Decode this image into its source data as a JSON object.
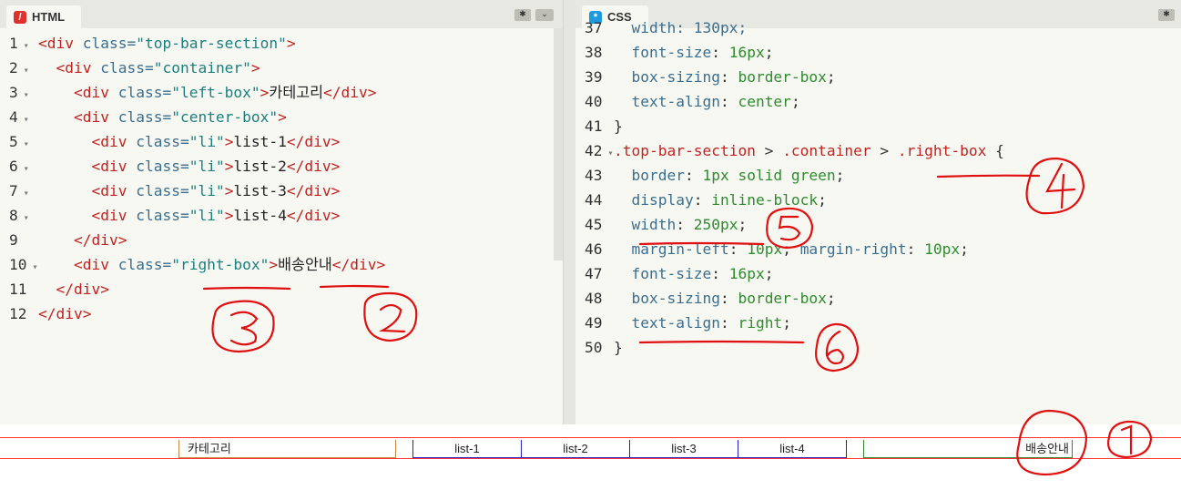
{
  "html_editor": {
    "tab_label": "HTML",
    "icon": "html-icon",
    "lines": [
      {
        "n": "1",
        "fold": true,
        "tokens": [
          {
            "c": "tag",
            "t": "<div "
          },
          {
            "c": "attr",
            "t": "class="
          },
          {
            "c": "str",
            "t": "\"top-bar-section\""
          },
          {
            "c": "tag",
            "t": ">"
          }
        ]
      },
      {
        "n": "2",
        "fold": true,
        "tokens": [
          {
            "c": "txt",
            "t": "  "
          },
          {
            "c": "tag",
            "t": "<div "
          },
          {
            "c": "attr",
            "t": "class="
          },
          {
            "c": "str",
            "t": "\"container\""
          },
          {
            "c": "tag",
            "t": ">"
          }
        ]
      },
      {
        "n": "3",
        "fold": true,
        "tokens": [
          {
            "c": "txt",
            "t": "    "
          },
          {
            "c": "tag",
            "t": "<div "
          },
          {
            "c": "attr",
            "t": "class="
          },
          {
            "c": "str",
            "t": "\"left-box\""
          },
          {
            "c": "tag",
            "t": ">"
          },
          {
            "c": "txt",
            "t": "카테고리"
          },
          {
            "c": "tag",
            "t": "</div>"
          }
        ]
      },
      {
        "n": "4",
        "fold": true,
        "tokens": [
          {
            "c": "txt",
            "t": "    "
          },
          {
            "c": "tag",
            "t": "<div "
          },
          {
            "c": "attr",
            "t": "class="
          },
          {
            "c": "str",
            "t": "\"center-box\""
          },
          {
            "c": "tag",
            "t": ">"
          }
        ]
      },
      {
        "n": "5",
        "fold": true,
        "tokens": [
          {
            "c": "txt",
            "t": "      "
          },
          {
            "c": "tag",
            "t": "<div "
          },
          {
            "c": "attr",
            "t": "class="
          },
          {
            "c": "str",
            "t": "\"li\""
          },
          {
            "c": "tag",
            "t": ">"
          },
          {
            "c": "txt",
            "t": "list-1"
          },
          {
            "c": "tag",
            "t": "</div>"
          }
        ]
      },
      {
        "n": "6",
        "fold": true,
        "tokens": [
          {
            "c": "txt",
            "t": "      "
          },
          {
            "c": "tag",
            "t": "<div "
          },
          {
            "c": "attr",
            "t": "class="
          },
          {
            "c": "str",
            "t": "\"li\""
          },
          {
            "c": "tag",
            "t": ">"
          },
          {
            "c": "txt",
            "t": "list-2"
          },
          {
            "c": "tag",
            "t": "</div>"
          }
        ]
      },
      {
        "n": "7",
        "fold": true,
        "tokens": [
          {
            "c": "txt",
            "t": "      "
          },
          {
            "c": "tag",
            "t": "<div "
          },
          {
            "c": "attr",
            "t": "class="
          },
          {
            "c": "str",
            "t": "\"li\""
          },
          {
            "c": "tag",
            "t": ">"
          },
          {
            "c": "txt",
            "t": "list-3"
          },
          {
            "c": "tag",
            "t": "</div>"
          }
        ]
      },
      {
        "n": "8",
        "fold": true,
        "tokens": [
          {
            "c": "txt",
            "t": "      "
          },
          {
            "c": "tag",
            "t": "<div "
          },
          {
            "c": "attr",
            "t": "class="
          },
          {
            "c": "str",
            "t": "\"li\""
          },
          {
            "c": "tag",
            "t": ">"
          },
          {
            "c": "txt",
            "t": "list-4"
          },
          {
            "c": "tag",
            "t": "</div>"
          }
        ]
      },
      {
        "n": "9",
        "fold": false,
        "tokens": [
          {
            "c": "txt",
            "t": "    "
          },
          {
            "c": "tag",
            "t": "</div>"
          }
        ]
      },
      {
        "n": "10",
        "fold": true,
        "tokens": [
          {
            "c": "txt",
            "t": "    "
          },
          {
            "c": "tag",
            "t": "<div "
          },
          {
            "c": "attr",
            "t": "class="
          },
          {
            "c": "str",
            "t": "\"right-box\""
          },
          {
            "c": "tag",
            "t": ">"
          },
          {
            "c": "txt",
            "t": "배송안내"
          },
          {
            "c": "tag",
            "t": "</div>"
          }
        ]
      },
      {
        "n": "11",
        "fold": false,
        "tokens": [
          {
            "c": "txt",
            "t": "  "
          },
          {
            "c": "tag",
            "t": "</div>"
          }
        ]
      },
      {
        "n": "12",
        "fold": false,
        "tokens": [
          {
            "c": "tag",
            "t": "</div>"
          }
        ]
      }
    ]
  },
  "css_editor": {
    "tab_label": "CSS",
    "icon": "css-icon",
    "partial_line": {
      "n": "37",
      "text": "  width: 130px;"
    },
    "lines": [
      {
        "n": "38",
        "fold": false,
        "tokens": [
          {
            "c": "prop",
            "t": "  font-size"
          },
          {
            "c": "pun",
            "t": ": "
          },
          {
            "c": "val",
            "t": "16px"
          },
          {
            "c": "pun",
            "t": ";"
          }
        ]
      },
      {
        "n": "39",
        "fold": false,
        "tokens": [
          {
            "c": "prop",
            "t": "  box-sizing"
          },
          {
            "c": "pun",
            "t": ": "
          },
          {
            "c": "val",
            "t": "border-box"
          },
          {
            "c": "pun",
            "t": ";"
          }
        ]
      },
      {
        "n": "40",
        "fold": false,
        "tokens": [
          {
            "c": "prop",
            "t": "  text-align"
          },
          {
            "c": "pun",
            "t": ": "
          },
          {
            "c": "val",
            "t": "center"
          },
          {
            "c": "pun",
            "t": ";"
          }
        ]
      },
      {
        "n": "41",
        "fold": false,
        "tokens": [
          {
            "c": "pun",
            "t": "}"
          }
        ]
      },
      {
        "n": "42",
        "fold": true,
        "tokens": [
          {
            "c": "sel",
            "t": ".top-bar-section"
          },
          {
            "c": "pun",
            "t": " > "
          },
          {
            "c": "sel",
            "t": ".container"
          },
          {
            "c": "pun",
            "t": " > "
          },
          {
            "c": "sel",
            "t": ".right-box"
          },
          {
            "c": "pun",
            "t": " {"
          }
        ]
      },
      {
        "n": "43",
        "fold": false,
        "tokens": [
          {
            "c": "prop",
            "t": "  border"
          },
          {
            "c": "pun",
            "t": ": "
          },
          {
            "c": "val",
            "t": "1px solid green"
          },
          {
            "c": "pun",
            "t": ";"
          }
        ]
      },
      {
        "n": "44",
        "fold": false,
        "tokens": [
          {
            "c": "prop",
            "t": "  display"
          },
          {
            "c": "pun",
            "t": ": "
          },
          {
            "c": "val",
            "t": "inline-block"
          },
          {
            "c": "pun",
            "t": ";"
          }
        ]
      },
      {
        "n": "45",
        "fold": false,
        "tokens": [
          {
            "c": "prop",
            "t": "  width"
          },
          {
            "c": "pun",
            "t": ": "
          },
          {
            "c": "val",
            "t": "250px"
          },
          {
            "c": "pun",
            "t": ";"
          }
        ]
      },
      {
        "n": "46",
        "fold": false,
        "tokens": [
          {
            "c": "prop",
            "t": "  margin-left"
          },
          {
            "c": "pun",
            "t": ": "
          },
          {
            "c": "val",
            "t": "10px"
          },
          {
            "c": "pun",
            "t": "; "
          },
          {
            "c": "prop",
            "t": "margin-right"
          },
          {
            "c": "pun",
            "t": ": "
          },
          {
            "c": "val",
            "t": "10px"
          },
          {
            "c": "pun",
            "t": ";"
          }
        ]
      },
      {
        "n": "47",
        "fold": false,
        "tokens": [
          {
            "c": "prop",
            "t": "  font-size"
          },
          {
            "c": "pun",
            "t": ": "
          },
          {
            "c": "val",
            "t": "16px"
          },
          {
            "c": "pun",
            "t": ";"
          }
        ]
      },
      {
        "n": "48",
        "fold": false,
        "tokens": [
          {
            "c": "prop",
            "t": "  box-sizing"
          },
          {
            "c": "pun",
            "t": ": "
          },
          {
            "c": "val",
            "t": "border-box"
          },
          {
            "c": "pun",
            "t": ";"
          }
        ]
      },
      {
        "n": "49",
        "fold": false,
        "tokens": [
          {
            "c": "prop",
            "t": "  text-align"
          },
          {
            "c": "pun",
            "t": ": "
          },
          {
            "c": "val",
            "t": "right"
          },
          {
            "c": "pun",
            "t": ";"
          }
        ]
      },
      {
        "n": "50",
        "fold": false,
        "tokens": [
          {
            "c": "pun",
            "t": "}"
          }
        ]
      }
    ]
  },
  "preview": {
    "left_box": "카테고리",
    "list_items": [
      "list-1",
      "list-2",
      "list-3",
      "list-4"
    ],
    "right_box": "배송안내"
  },
  "colors": {
    "html_icon": "#e0302b",
    "css_icon": "#1e9be0",
    "annotation_ink": "#e01010",
    "left_box_border": "#cc8844",
    "li_border": "#2222cc",
    "right_box_border": "#2e8b2e"
  }
}
